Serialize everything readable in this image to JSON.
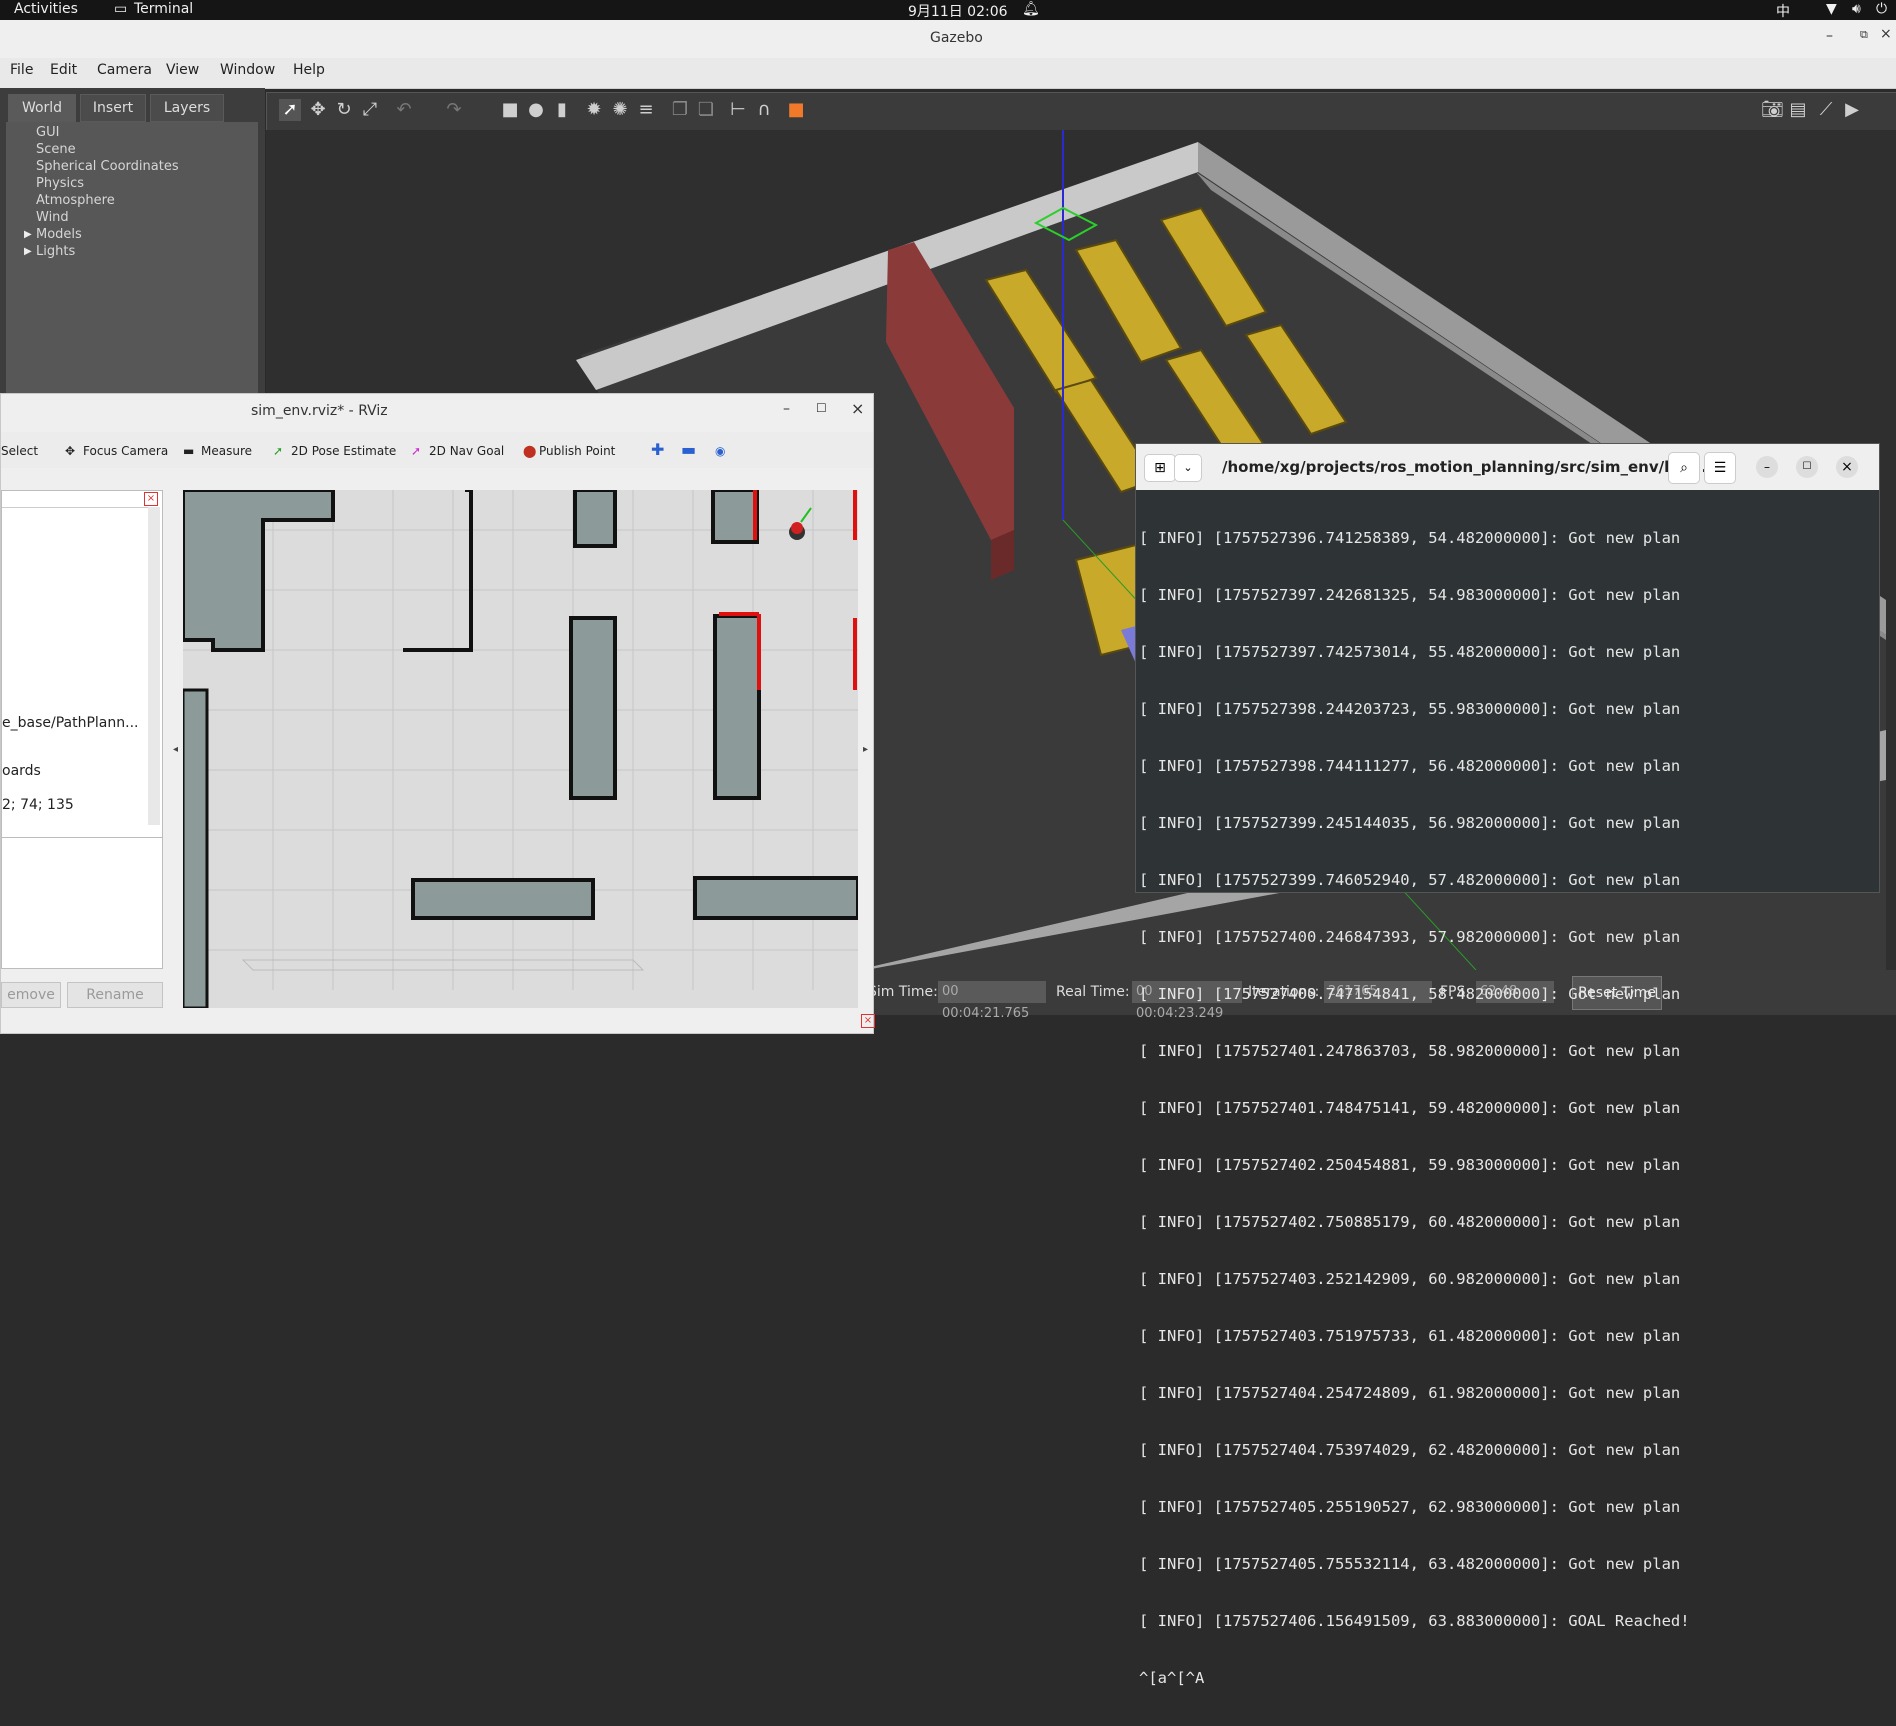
{
  "topbar": {
    "activities": "Activities",
    "app": "Terminal",
    "clock": "9月11日  02:06",
    "input_method": "中"
  },
  "gazebo": {
    "title": "Gazebo",
    "menu": [
      "File",
      "Edit",
      "Camera",
      "View",
      "Window",
      "Help"
    ],
    "tabs": [
      "World",
      "Insert",
      "Layers"
    ],
    "tree": [
      "GUI",
      "Scene",
      "Spherical Coordinates",
      "Physics",
      "Atmosphere",
      "Wind",
      "Models",
      "Lights"
    ],
    "bottom": {
      "sim_time_label": "Sim Time:",
      "sim_time": "00 00:04:21.765",
      "real_time_label": "Real Time:",
      "real_time": "00 00:04:23.249",
      "iterations_label": "Iterations:",
      "iterations": "261765",
      "fps_label": "FPS:",
      "fps": "62.48",
      "reset_time": "Reset Time"
    }
  },
  "rviz": {
    "title": "sim_env.rviz* - RViz",
    "tools": {
      "select": "Select",
      "focus_camera": "Focus Camera",
      "measure": "Measure",
      "pose_estimate": "2D Pose Estimate",
      "nav_goal": "2D Nav Goal",
      "publish_point": "Publish Point"
    },
    "panel_texts": {
      "planner": "e_base/PathPlann...",
      "boards": "oards",
      "color": "2; 74; 135"
    },
    "remove": "emove",
    "rename": "Rename"
  },
  "terminal": {
    "path": "/home/xg/projects/ros_motion_planning/src/sim_env/lau...",
    "lines": [
      "[ INFO] [1757527396.741258389, 54.482000000]: Got new plan",
      "[ INFO] [1757527397.242681325, 54.983000000]: Got new plan",
      "[ INFO] [1757527397.742573014, 55.482000000]: Got new plan",
      "[ INFO] [1757527398.244203723, 55.983000000]: Got new plan",
      "[ INFO] [1757527398.744111277, 56.482000000]: Got new plan",
      "[ INFO] [1757527399.245144035, 56.982000000]: Got new plan",
      "[ INFO] [1757527399.746052940, 57.482000000]: Got new plan",
      "[ INFO] [1757527400.246847393, 57.982000000]: Got new plan",
      "[ INFO] [1757527400.747154841, 58.482000000]: Got new plan",
      "[ INFO] [1757527401.247863703, 58.982000000]: Got new plan",
      "[ INFO] [1757527401.748475141, 59.482000000]: Got new plan",
      "[ INFO] [1757527402.250454881, 59.983000000]: Got new plan",
      "[ INFO] [1757527402.750885179, 60.482000000]: Got new plan",
      "[ INFO] [1757527403.252142909, 60.982000000]: Got new plan",
      "[ INFO] [1757527403.751975733, 61.482000000]: Got new plan",
      "[ INFO] [1757527404.254724809, 61.982000000]: Got new plan",
      "[ INFO] [1757527404.753974029, 62.482000000]: Got new plan",
      "[ INFO] [1757527405.255190527, 62.983000000]: Got new plan",
      "[ INFO] [1757527405.755532114, 63.482000000]: Got new plan",
      "[ INFO] [1757527406.156491509, 63.883000000]: GOAL Reached!",
      "^[a^[^A"
    ]
  }
}
